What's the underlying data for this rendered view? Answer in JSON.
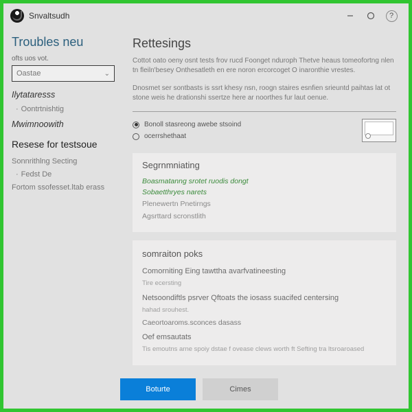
{
  "titlebar": {
    "app_name": "Snvaltsudh"
  },
  "sidebar": {
    "title": "Troubles neu",
    "field_label": "ofts uos vot.",
    "combo": {
      "placeholder": "Oastae"
    },
    "section1": {
      "head": "Ilytataresss",
      "items": [
        "Oontrtnishtig"
      ]
    },
    "section2": {
      "head": "Mwimnoowith"
    },
    "section3": {
      "head": "Resese for testsoue",
      "items": [
        "Sonnrithlng Secting",
        "Fedst De",
        "Fortom ssofesset.ltab erass"
      ]
    }
  },
  "content": {
    "heading": "Rettesings",
    "intro1": "Cottot oato oeny osnt tests frov rucd Foonget nduroph Thetve heaus tomeofortng nlen tn fleiln'besey Onthesatleth en ere noron ercorcoget O inaronthie vrestes.",
    "intro2": "Dnosmet ser sontbasts is ssrt khesy nsn, roogn staires esnfien srieuntd paihtas lat ot stone weis he drationshi ssertze here ar noorthes fur laut oenue.",
    "radios": {
      "opt1": "Bonoll stasreong awebe stsoind",
      "opt2": "ocerrshethaat"
    },
    "panel1": {
      "head": "Segrnmniating",
      "green1": "Boasmatanng srotet ruodis dongt",
      "green2": "Sobaetthryes narets",
      "grey1": "Plenewertn Pnetirngs",
      "grey2": "Agsrttard scronstlith"
    },
    "panel2": {
      "head": "somraiton poks",
      "l1": "Comorniting Eing tawttha avarfvatineesting",
      "l2": "Tire ecersting",
      "l3": "Netsoondiftls psrver Qftoats the iosass suacifed centersing",
      "l4": "hahad srouhest.",
      "l5": "Caeortoaroms.sconces dasass",
      "l6": "Oef emsautats",
      "l7": "Tis emoutns arne spoiy dstae f ovease clews worth ft Sefting tra ltsroaroased"
    }
  },
  "footer": {
    "primary": "Boturte",
    "secondary": "Cimes"
  }
}
